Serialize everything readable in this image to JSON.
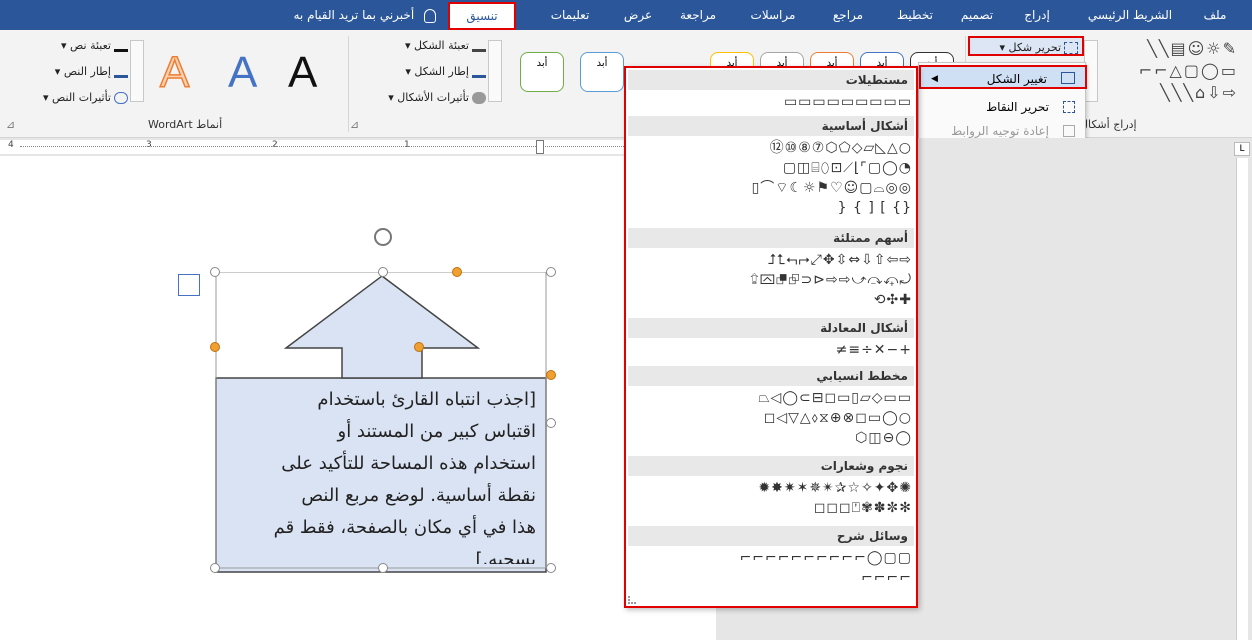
{
  "tabs": {
    "file": "ملف",
    "home": "الشريط الرئيسي",
    "insert": "إدراج",
    "design": "تصميم",
    "layout": "تخطيط",
    "references": "مراجع",
    "mailings": "مراسلات",
    "review": "مراجعة",
    "view": "عرض",
    "help": "تعليمات",
    "format": "تنسيق",
    "tell_me": "أخبرني بما تريد القيام به"
  },
  "ribbon": {
    "insert_shapes_label": "إدراج أشكال",
    "edit_shape": "تحرير شكل ▾",
    "shape_fill": "تعبئة الشكل ▾",
    "shape_outline": "إطار الشكل ▾",
    "shape_effects": "تأثيرات الأشكال ▾",
    "text_fill": "تعبئة نص ▾",
    "text_outline": "إطار النص ▾",
    "text_effects": "تأثيرات النص ▾",
    "wordart_label": "أنماط WordArt",
    "style_sample": "أبد",
    "wordart_letter": "A",
    "dialog_launcher": "⊿"
  },
  "edit_menu": {
    "change_shape": "تغيير الشكل",
    "edit_points": "تحرير النقاط",
    "reroute_connectors": "إعادة توجيه الروابط"
  },
  "gallery": {
    "sections": [
      {
        "title": "مستطيلات",
        "rows": [
          "▭▭▭▭▭▭▭▭▭"
        ]
      },
      {
        "title": "أشكال أساسية",
        "rows": [
          "⑫⑩⑧⑦⬡⬠◇▱◺△○",
          "▢◫⌸⬯⊡⟋⌊⌜▢◯◔",
          "▯⌒⌔☾☼⚑♡☺▢⌓◎◎",
          "} { ] [ {}"
        ]
      },
      {
        "title": "أسهم ممتلئة",
        "rows": [
          "⮥⮤⮢⮣⤢✥⇳⇔⇩⇧⇦⇨",
          "⮸⮹⮻⮺⊃⊳⇨⇨⤻⤼⤽⤾",
          "⟲✣✚"
        ]
      },
      {
        "title": "أشكال المعادلة",
        "rows": [
          "≠≡÷✕−+"
        ]
      },
      {
        "title": "مخطط انسيابي",
        "rows": [
          "⏢◁◯⊂⊟◻▭▯▱◇▭▭",
          "◻◁▽△⬨⧖⊕⊗◻▭◯○",
          "⬡◫⊖◯"
        ]
      },
      {
        "title": "نجوم وشعارات",
        "rows": [
          "✹✸✷✶✵✴✰☆✧✦✥✺",
          "◻◻◻⍞✾✽✼✻"
        ]
      },
      {
        "title": "وسائل شرح",
        "rows": [
          "⌐⌐⌐⌐⌐⌐⌐⌐⌐⌐◯▢▢",
          "⌐⌐⌐⌐"
        ]
      }
    ]
  },
  "document": {
    "callout_lines": [
      "[اجذب انتباه القارئ باستخدام",
      "اقتباس كبير من المستند أو",
      "استخدام هذه المساحة للتأكيد على",
      "نقطة أساسية. لوضع مربع النص",
      "هذا في أي مكان بالصفحة، فقط قم",
      "بسحبه.]"
    ],
    "shape_fill": "#dae3f3",
    "shape_outline": "#444444"
  },
  "ruler": {
    "numbers": [
      "4",
      "3",
      "2",
      "1"
    ]
  },
  "colors": {
    "accent": "#2b579a",
    "highlight": "#e00000"
  }
}
